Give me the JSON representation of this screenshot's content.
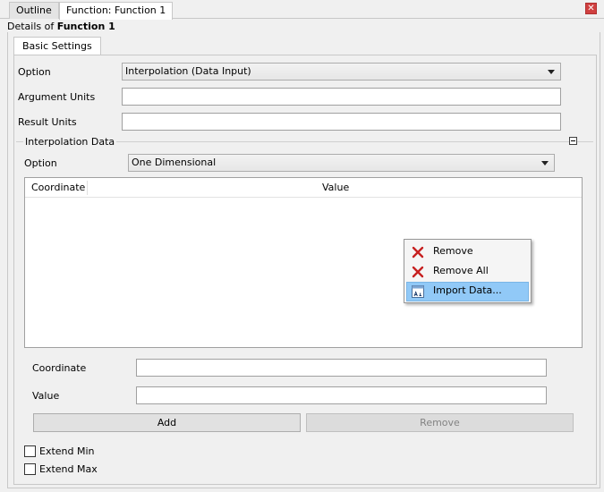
{
  "tabs": [
    {
      "label": "Outline"
    },
    {
      "label": "Function: Function 1"
    }
  ],
  "close_glyph": "✕",
  "details": {
    "prefix": "Details of ",
    "name": "Function 1"
  },
  "basic_tab": {
    "label": "Basic Settings"
  },
  "fields": {
    "option_label": "Option",
    "option_value": "Interpolation (Data Input)",
    "argument_units_label": "Argument Units",
    "argument_units_value": "",
    "result_units_label": "Result Units",
    "result_units_value": ""
  },
  "interpolation": {
    "title": "Interpolation Data",
    "option_label": "Option",
    "option_value": "One Dimensional",
    "table": {
      "columns": [
        "Coordinate",
        "Value"
      ],
      "rows": []
    },
    "coordinate_label": "Coordinate",
    "coordinate_value": "",
    "value_label": "Value",
    "value_value": "",
    "add_label": "Add",
    "remove_label": "Remove",
    "extend_min": {
      "label": "Extend Min",
      "checked": false
    },
    "extend_max": {
      "label": "Extend Max",
      "checked": false
    }
  },
  "context_menu": {
    "items": [
      {
        "label": "Remove",
        "icon": "red-x-icon"
      },
      {
        "label": "Remove All",
        "icon": "red-x-icon"
      },
      {
        "label": "Import Data...",
        "icon": "import-data-icon",
        "highlighted": true
      }
    ]
  },
  "colors": {
    "highlight": "#91c9f7",
    "delete_red": "#c62020"
  }
}
